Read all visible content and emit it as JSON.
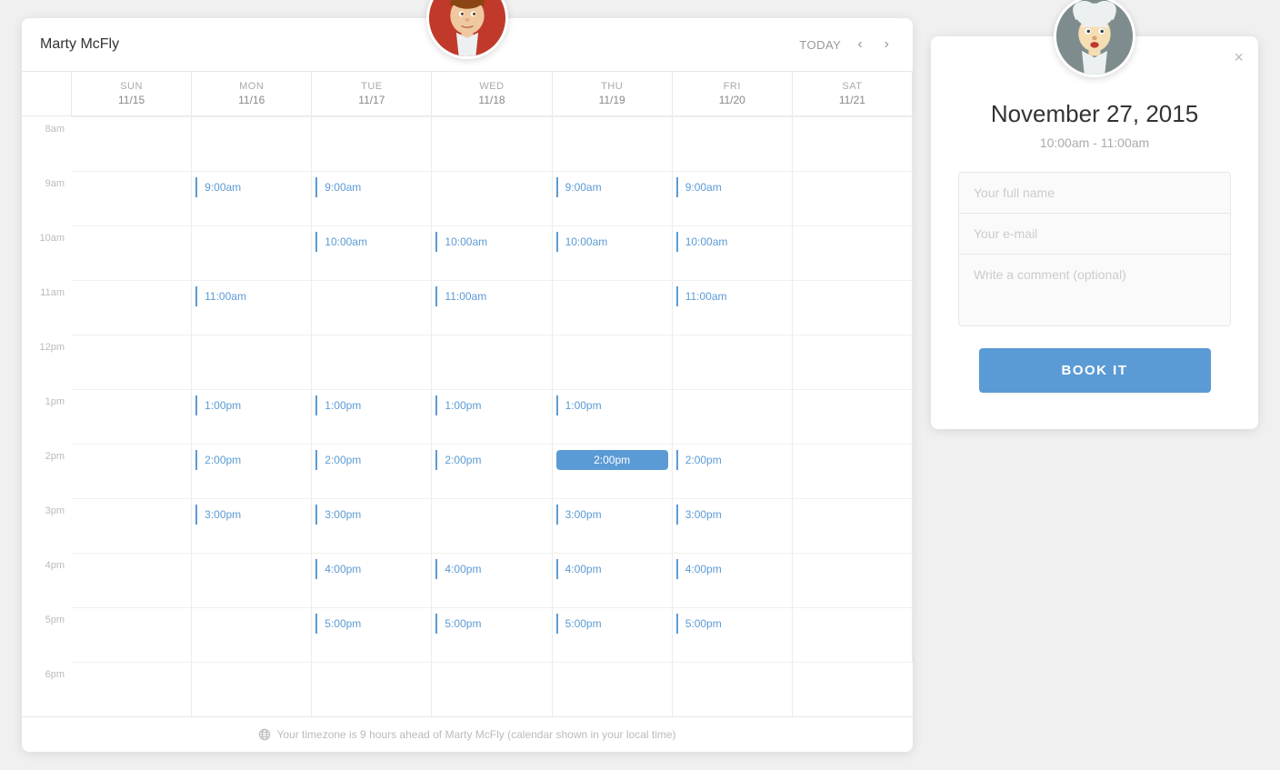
{
  "calendar": {
    "title": "Marty McFly",
    "nav": {
      "today_label": "TODAY"
    },
    "days": [
      {
        "name": "SUN",
        "date": "11/15"
      },
      {
        "name": "MON",
        "date": "11/16"
      },
      {
        "name": "TUE",
        "date": "11/17"
      },
      {
        "name": "WED",
        "date": "11/18"
      },
      {
        "name": "THU",
        "date": "11/19"
      },
      {
        "name": "FRI",
        "date": "11/20"
      },
      {
        "name": "SAT",
        "date": "11/21"
      }
    ],
    "times": [
      {
        "label": "8am",
        "slots": [
          "",
          "",
          "",
          "",
          "",
          "",
          ""
        ]
      },
      {
        "label": "9am",
        "slots": [
          "",
          "9:00am",
          "9:00am",
          "",
          "9:00am",
          "9:00am",
          ""
        ]
      },
      {
        "label": "10am",
        "slots": [
          "",
          "",
          "10:00am",
          "10:00am",
          "10:00am",
          "10:00am",
          ""
        ]
      },
      {
        "label": "11am",
        "slots": [
          "",
          "11:00am",
          "",
          "11:00am",
          "",
          "11:00am",
          ""
        ]
      },
      {
        "label": "12pm",
        "slots": [
          "",
          "",
          "",
          "",
          "",
          "",
          ""
        ]
      },
      {
        "label": "1pm",
        "slots": [
          "",
          "1:00pm",
          "1:00pm",
          "1:00pm",
          "1:00pm",
          "",
          ""
        ]
      },
      {
        "label": "2pm",
        "slots": [
          "",
          "2:00pm",
          "2:00pm",
          "2:00pm",
          "2:00pm",
          "2:00pm",
          ""
        ]
      },
      {
        "label": "3pm",
        "slots": [
          "",
          "3:00pm",
          "3:00pm",
          "",
          "3:00pm",
          "3:00pm",
          ""
        ]
      },
      {
        "label": "4pm",
        "slots": [
          "",
          "",
          "4:00pm",
          "4:00pm",
          "4:00pm",
          "4:00pm",
          ""
        ]
      },
      {
        "label": "5pm",
        "slots": [
          "",
          "",
          "5:00pm",
          "5:00pm",
          "5:00pm",
          "5:00pm",
          ""
        ]
      },
      {
        "label": "6pm",
        "slots": [
          "",
          "",
          "",
          "",
          "",
          "",
          ""
        ]
      }
    ],
    "footer": "Your timezone is 9 hours ahead of Marty McFly (calendar shown in your local time)",
    "selected": {
      "day_index": 4,
      "time_index": 6
    }
  },
  "booking": {
    "date": "November 27, 2015",
    "time_range": "10:00am - 11:00am",
    "form": {
      "name_placeholder": "Your full name",
      "email_placeholder": "Your e-mail",
      "comment_placeholder": "Write a comment (optional)"
    },
    "book_label": "BOOK IT",
    "close_label": "×"
  }
}
